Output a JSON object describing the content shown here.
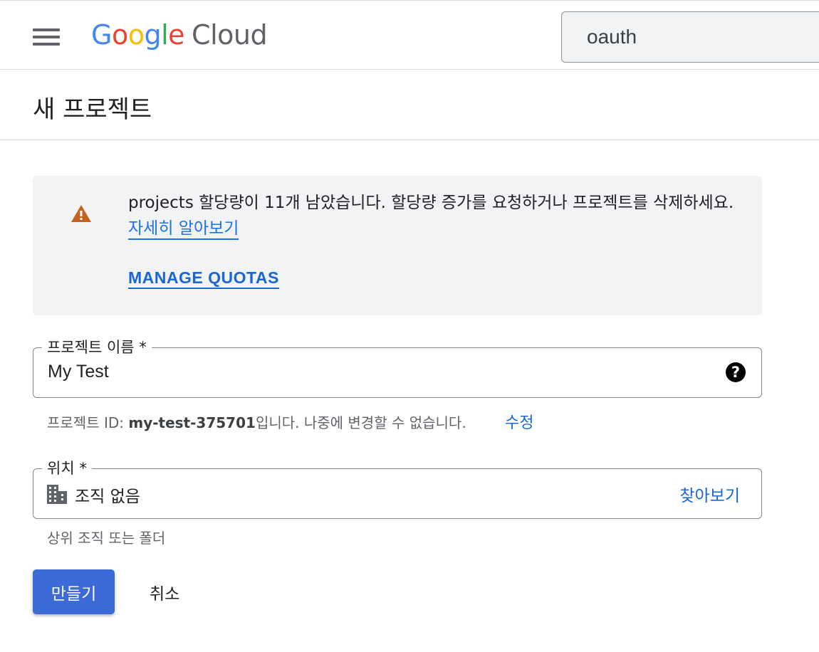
{
  "header": {
    "logo": {
      "g1": "G",
      "g2": "o",
      "g3": "o",
      "g4": "g",
      "g5": "l",
      "g6": "e",
      "product": "Cloud"
    },
    "search": {
      "value": "oauth"
    }
  },
  "page": {
    "title": "새 프로젝트"
  },
  "alert": {
    "icon": "warning-icon",
    "icon_color": "#c5621d",
    "message": "projects 할당량이 11개 남았습니다. 할당량 증가를 요청하거나 프로젝트를 삭제하세요.",
    "learn_more": "자세히 알아보기",
    "manage_quotas": "MANAGE QUOTAS"
  },
  "project_name": {
    "label": "프로젝트 이름 *",
    "value": "My Test",
    "help_icon": "help-icon"
  },
  "project_id": {
    "prefix": "프로젝트 ID: ",
    "id": "my-test-375701",
    "suffix": "입니다. 나중에 변경할 수 없습니다.",
    "edit": "수정"
  },
  "location": {
    "label": "위치 *",
    "icon": "building-icon",
    "value": "조직 없음",
    "browse": "찾아보기",
    "hint": "상위 조직 또는 폴더"
  },
  "actions": {
    "create": "만들기",
    "cancel": "취소",
    "primary_color": "#3c6ad6"
  }
}
